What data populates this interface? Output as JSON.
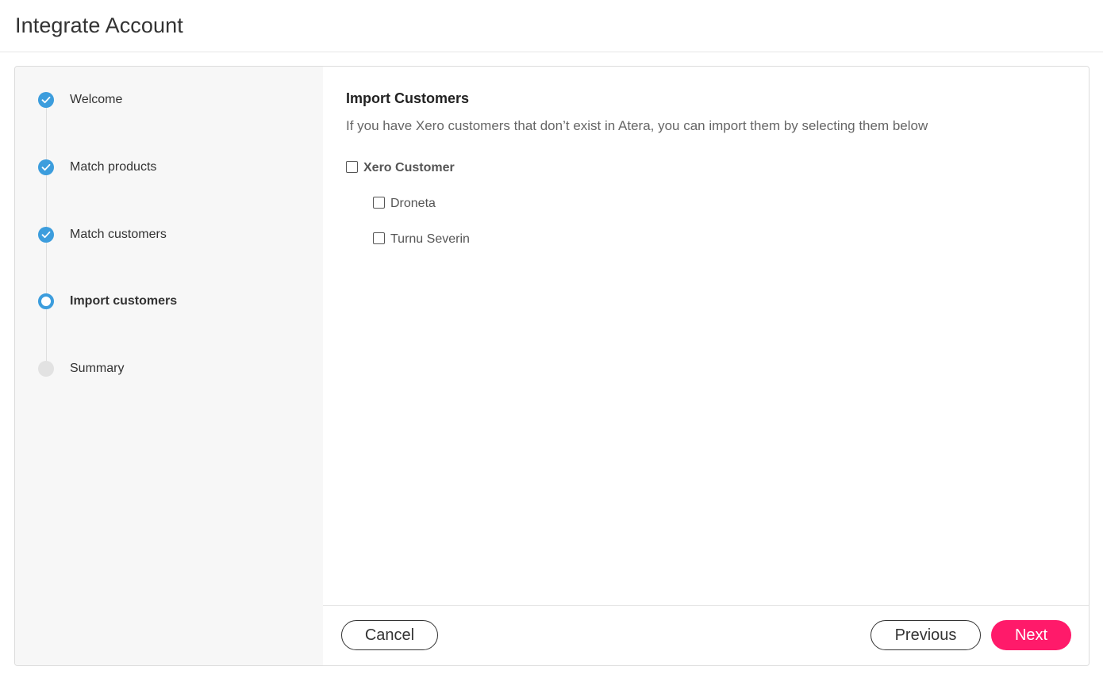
{
  "header": {
    "title": "Integrate Account"
  },
  "steps": [
    {
      "label": "Welcome",
      "state": "done"
    },
    {
      "label": "Match products",
      "state": "done"
    },
    {
      "label": "Match customers",
      "state": "done"
    },
    {
      "label": "Import customers",
      "state": "current"
    },
    {
      "label": "Summary",
      "state": "pending"
    }
  ],
  "content": {
    "title": "Import Customers",
    "description": "If you have Xero customers that don’t exist in Atera, you can import them by selecting them below",
    "tree": {
      "parent": {
        "label": "Xero Customer",
        "checked": false
      },
      "children": [
        {
          "label": "Droneta",
          "checked": false
        },
        {
          "label": "Turnu Severin",
          "checked": false
        }
      ]
    }
  },
  "footer": {
    "cancel_label": "Cancel",
    "previous_label": "Previous",
    "next_label": "Next"
  },
  "colors": {
    "accent": "#3c9ddd",
    "primary_button": "#ff1a6a",
    "pending_step": "#e2e2e2"
  },
  "icons": {
    "step_done": "check-icon",
    "step_current": "ring-icon",
    "step_pending": "dot-icon"
  }
}
